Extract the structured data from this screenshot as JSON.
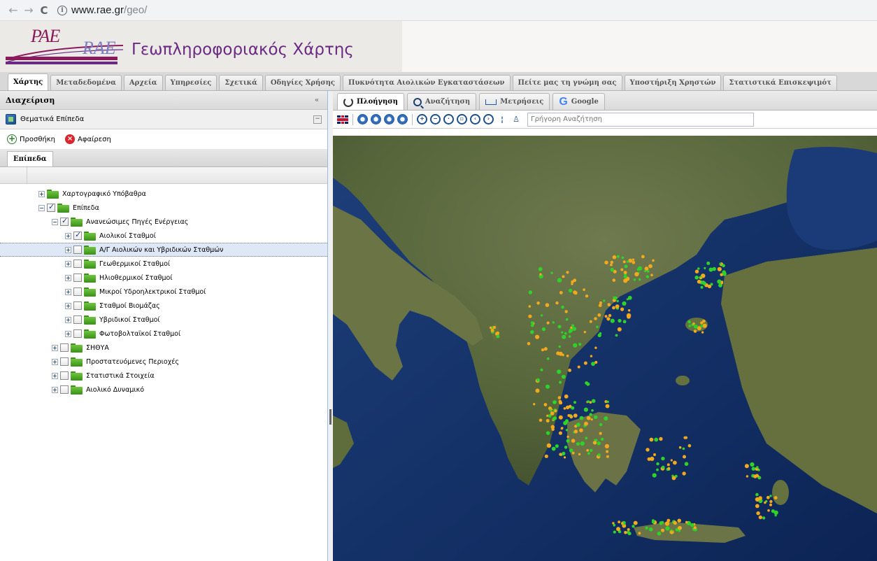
{
  "browser": {
    "url_host": "www.rae.gr",
    "url_path": "/geo/",
    "back_glyph": "←",
    "forward_glyph": "→",
    "reload_glyph": "C",
    "info_glyph": "i"
  },
  "header": {
    "logo_pae": "PAE",
    "logo_rae": "RAE",
    "title": "Γεωπληροφοριακός Χάρτης"
  },
  "main_tabs": [
    {
      "label": "Χάρτης",
      "active": true
    },
    {
      "label": "Μεταδεδομένα"
    },
    {
      "label": "Αρχεία"
    },
    {
      "label": "Υπηρεσίες"
    },
    {
      "label": "Σχετικά"
    },
    {
      "label": "Οδηγίες Χρήσης"
    },
    {
      "label": "Πυκνότητα Αιολικών Εγκαταστάσεων"
    },
    {
      "label": "Πείτε μας τη γνώμη σας"
    },
    {
      "label": "Υποστήριξη Χρηστών"
    },
    {
      "label": "Στατιστικά Επισκεψιμότ"
    }
  ],
  "left_panel": {
    "title": "Διαχείριση",
    "collapse_glyph": "«",
    "section_title": "Θεματικά Επίπεδα",
    "minimize_glyph": "−",
    "add_label": "Προσθήκη",
    "remove_label": "Αφαίρεση",
    "add_glyph": "+",
    "remove_glyph": "×",
    "tab_label": "Επίπεδα",
    "tree": [
      {
        "label": "Χαρτογραφικό Υπόβαθρα",
        "level": 0,
        "expander": "+",
        "checkbox": false,
        "checked": false
      },
      {
        "label": "Επίπεδα",
        "level": 0,
        "expander": "−",
        "checkbox": true,
        "checked": true
      },
      {
        "label": "Ανανεώσιμες Πηγές Ενέργειας",
        "level": 1,
        "expander": "−",
        "checkbox": true,
        "checked": true
      },
      {
        "label": "Αιολικοί Σταθμοί",
        "level": 2,
        "expander": "+",
        "checkbox": true,
        "checked": true
      },
      {
        "label": "Α/Γ Αιολικών και Υβριδικών Σταθμών",
        "level": 2,
        "expander": "+",
        "checkbox": true,
        "checked": false,
        "selected": true
      },
      {
        "label": "Γεωθερμικοί Σταθμοί",
        "level": 2,
        "expander": "+",
        "checkbox": true,
        "checked": false
      },
      {
        "label": "Ηλιοθερμικοί Σταθμοί",
        "level": 2,
        "expander": "+",
        "checkbox": true,
        "checked": false
      },
      {
        "label": "Μικροί Υδροηλεκτρικοί Σταθμοί",
        "level": 2,
        "expander": "+",
        "checkbox": true,
        "checked": false
      },
      {
        "label": "Σταθμοί Βιομάζας",
        "level": 2,
        "expander": "+",
        "checkbox": true,
        "checked": false
      },
      {
        "label": "Υβριδικοί Σταθμοί",
        "level": 2,
        "expander": "+",
        "checkbox": true,
        "checked": false
      },
      {
        "label": "Φωτοβολταϊκοί Σταθμοί",
        "level": 2,
        "expander": "+",
        "checkbox": true,
        "checked": false
      },
      {
        "label": "ΣΗΘΥΑ",
        "level": 1,
        "expander": "+",
        "checkbox": true,
        "checked": false
      },
      {
        "label": "Προστατευόμενες Περιοχές",
        "level": 1,
        "expander": "+",
        "checkbox": true,
        "checked": false
      },
      {
        "label": "Στατιστικά Στοιχεία",
        "level": 1,
        "expander": "+",
        "checkbox": true,
        "checked": false
      },
      {
        "label": "Αιολικό Δυναμικό",
        "level": 1,
        "expander": "+",
        "checkbox": true,
        "checked": false
      }
    ]
  },
  "map_tabs": [
    {
      "label": "Πλοήγηση",
      "icon": "navigation-icon",
      "active": true
    },
    {
      "label": "Αναζήτηση",
      "icon": "search-icon"
    },
    {
      "label": "Μετρήσεις",
      "icon": "measure-icon"
    },
    {
      "label": "Google",
      "icon": "google-icon"
    }
  ],
  "map_toolbar": {
    "quick_search_placeholder": "Γρήγορη Αναζήτηση",
    "tools": [
      {
        "name": "pan-west-icon",
        "glyph": "‹"
      },
      {
        "name": "pan-north-icon",
        "glyph": "˄"
      },
      {
        "name": "pan-south-icon",
        "glyph": "˅"
      },
      {
        "name": "pan-east-icon",
        "glyph": "›"
      },
      {
        "name": "zoom-in-icon",
        "glyph": "+"
      },
      {
        "name": "zoom-out-icon",
        "glyph": "−"
      },
      {
        "name": "zoom-box-icon",
        "glyph": "·"
      },
      {
        "name": "zoom-extent-icon",
        "glyph": "▫"
      },
      {
        "name": "zoom-previous-icon",
        "glyph": "‹"
      },
      {
        "name": "zoom-next-icon",
        "glyph": "›"
      }
    ]
  },
  "colors": {
    "site_purple": "#6b2a82",
    "logo_magenta": "#8b1a5a",
    "sea": "#0f2a5c",
    "land": "#5a6a3a",
    "wind_station_green": "#2ed32a",
    "wind_station_orange": "#f4a81c"
  }
}
